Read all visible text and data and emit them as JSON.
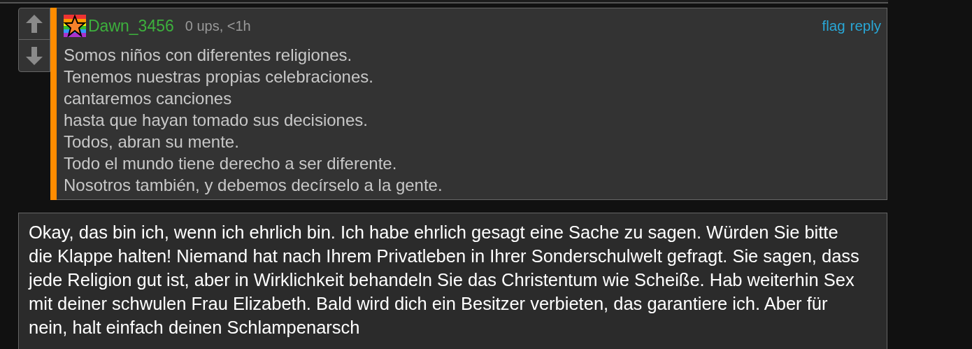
{
  "comment": {
    "username": "Dawn_3456",
    "meta": "0 ups, <1h",
    "actions": [
      "flag",
      "reply"
    ],
    "lines": [
      "Somos niños con diferentes religiones.",
      "Tenemos nuestras propias celebraciones.",
      "cantaremos canciones",
      "hasta que hayan tomado sus decisiones.",
      "Todos, abran su mente.",
      "Todo el mundo tiene derecho a ser diferente.",
      "Nosotros también, y debemos decírselo a la gente."
    ]
  },
  "reply_text": "Okay, das bin ich, wenn ich ehrlich bin. Ich habe ehrlich gesagt eine Sache zu sagen. Würden Sie bitte die Klappe halten! Niemand hat nach Ihrem Privatleben in Ihrer Sonderschulwelt gefragt. Sie sagen, dass jede Religion gut ist, aber in Wirklichkeit behandeln Sie das Christentum wie Scheiße. Hab weiterhin Sex mit deiner schwulen Frau Elizabeth. Bald wird dich ein Besitzer verbieten, das garantiere ich. Aber für nein, halt einfach deinen Schlampenarsch"
}
